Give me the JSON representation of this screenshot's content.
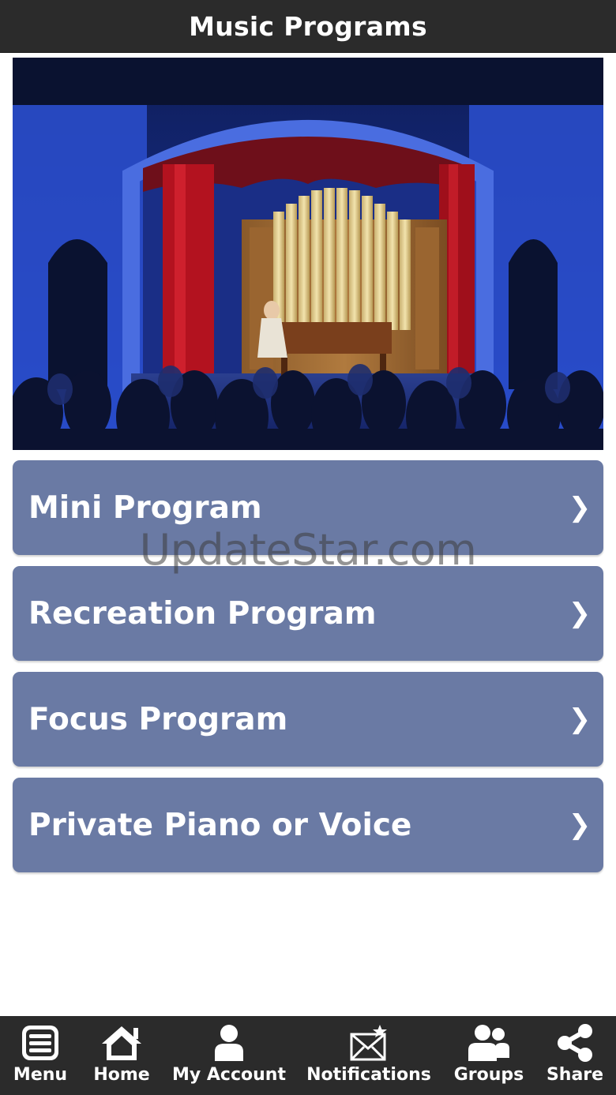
{
  "header": {
    "title": "Music Programs"
  },
  "hero": {
    "description": "Concert stage with organ pipes and pianist"
  },
  "programs": [
    {
      "label": "Mini Program",
      "chevron": "❯"
    },
    {
      "label": "Recreation Program",
      "chevron": "❯"
    },
    {
      "label": "Focus Program",
      "chevron": "❯"
    },
    {
      "label": "Private Piano or Voice",
      "chevron": "❯"
    }
  ],
  "watermark": {
    "text": "UpdateStar.com"
  },
  "bottom_nav": [
    {
      "label": "Menu",
      "icon": "menu-icon"
    },
    {
      "label": "Home",
      "icon": "home-icon"
    },
    {
      "label": "My Account",
      "icon": "account-icon"
    },
    {
      "label": "Notifications",
      "icon": "notifications-icon"
    },
    {
      "label": "Groups",
      "icon": "groups-icon"
    },
    {
      "label": "Share",
      "icon": "share-icon"
    }
  ],
  "colors": {
    "bar": "#2b2b2b",
    "button": "#6a7aa4",
    "text": "#ffffff"
  }
}
